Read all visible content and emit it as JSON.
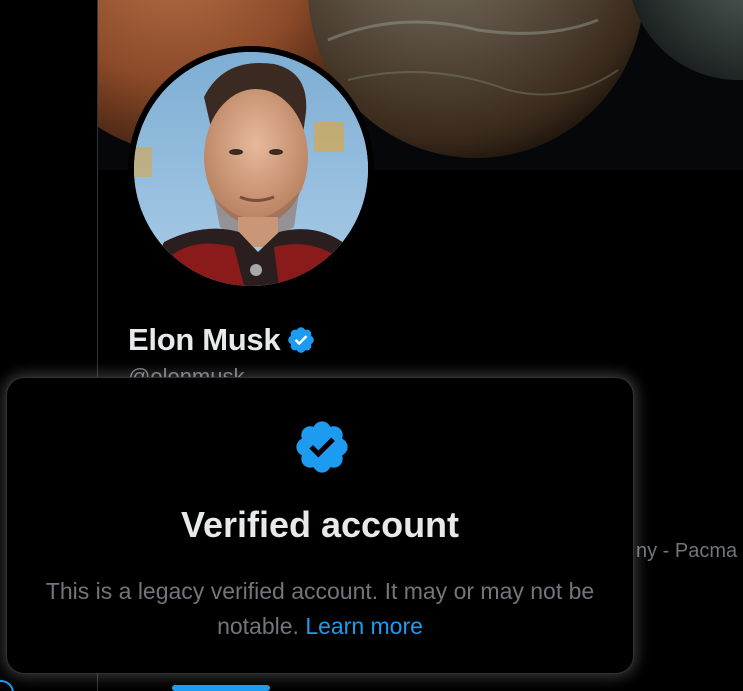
{
  "profile": {
    "display_name": "Elon Musk",
    "handle": "@elonmusk",
    "bio_fragment": "ny - Pacma"
  },
  "popover": {
    "title": "Verified account",
    "body_text": "This is a legacy verified account. It may or may not be notable.",
    "link_label": "Learn more"
  },
  "icons": {
    "verified": "verified-badge-icon",
    "corner": "circle-icon"
  },
  "colors": {
    "background": "#000000",
    "primary_text": "#e7e9ea",
    "secondary_text": "#71767b",
    "accent": "#1d9bf0",
    "border": "#2f3336"
  }
}
